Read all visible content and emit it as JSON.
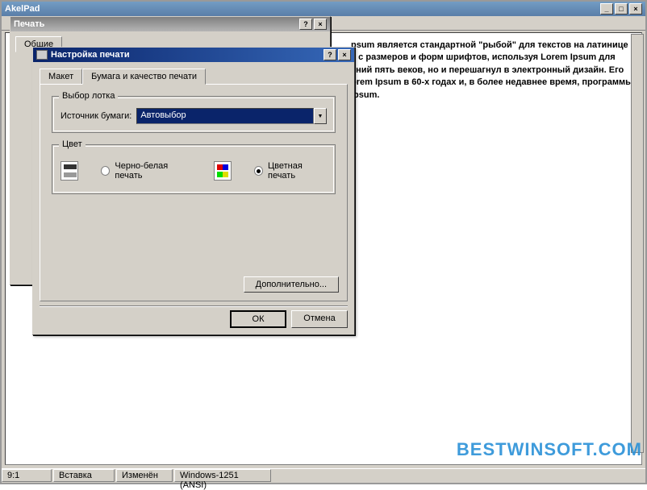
{
  "main_window": {
    "title": "AkelPad",
    "document_text": "psum является стандартной \"рыбой\" для текстов на латинице с с размеров и форм шрифтов, используя Lorem Ipsum для ений пять веков, но и перешагнул в электронный дизайн. Его orem Ipsum в 60-х годах и, в более недавнее время, программы Ipsum."
  },
  "status_bar": {
    "position": "9:1",
    "mode": "Вставка",
    "state": "Изменён",
    "encoding": "Windows-1251 (ANSI)"
  },
  "print_dialog": {
    "title": "Печать",
    "tab_general": "Общие"
  },
  "setup_dialog": {
    "title": "Настройка печати",
    "tab_layout": "Макет",
    "tab_paper": "Бумага и качество печати",
    "group_tray": "Выбор лотка",
    "source_label": "Источник бумаги:",
    "source_value": "Автовыбор",
    "group_color": "Цвет",
    "radio_bw": "Черно-белая печать",
    "radio_color": "Цветная печать",
    "btn_advanced": "Дополнительно...",
    "btn_ok": "ОК",
    "btn_cancel": "Отмена"
  },
  "watermark": "BESTWINSOFT.COM"
}
